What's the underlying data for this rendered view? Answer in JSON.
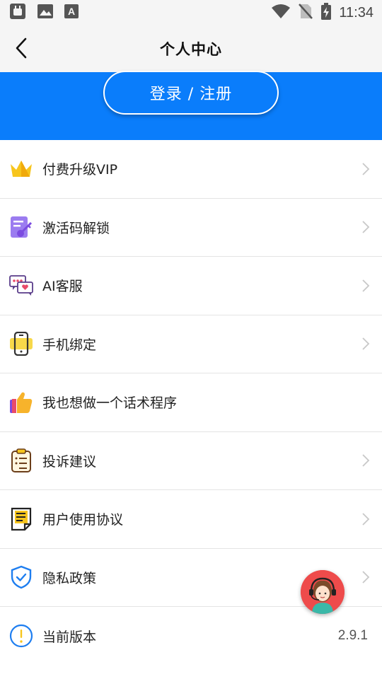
{
  "status_bar": {
    "time": "11:34",
    "notification_icons": [
      "android-robot-icon",
      "image-icon",
      "font-a-icon"
    ],
    "status_icons": [
      "wifi-icon",
      "no-sim-icon",
      "battery-charging-icon"
    ]
  },
  "header": {
    "title": "个人中心",
    "back_icon": "chevron-left-icon"
  },
  "banner": {
    "background_color": "#0a7dfb",
    "login_label": "登录 / 注册"
  },
  "menu": {
    "items": [
      {
        "label": "付费升级VIP",
        "icon": "crown-icon",
        "chevron": true
      },
      {
        "label": "激活码解锁",
        "icon": "activation-code-icon",
        "chevron": true
      },
      {
        "label": "AI客服",
        "icon": "chat-bubbles-icon",
        "chevron": true
      },
      {
        "label": "手机绑定",
        "icon": "phone-icon",
        "chevron": true
      },
      {
        "label": "我也想做一个话术程序",
        "icon": "thumbs-up-icon",
        "chevron": false
      },
      {
        "label": "投诉建议",
        "icon": "clipboard-icon",
        "chevron": true
      },
      {
        "label": "用户使用协议",
        "icon": "document-icon",
        "chevron": true
      },
      {
        "label": "隐私政策",
        "icon": "shield-check-icon",
        "chevron": true
      },
      {
        "label": "当前版本",
        "icon": "exclamation-circle-icon",
        "chevron": false,
        "value": "2.9.1"
      }
    ]
  },
  "floating": {
    "icon": "customer-service-avatar-icon"
  }
}
